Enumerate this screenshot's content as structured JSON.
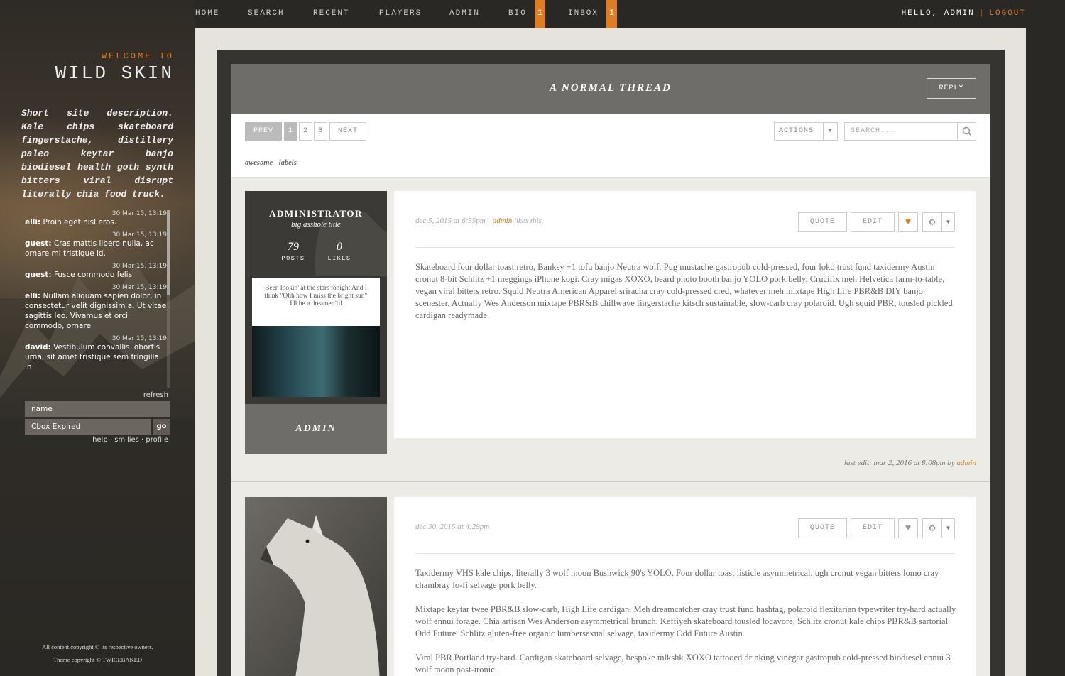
{
  "nav": {
    "items": [
      "HOME",
      "SEARCH",
      "RECENT",
      "PLAYERS",
      "ADMIN",
      "BIO",
      "INBOX"
    ],
    "bio_badge": "1",
    "inbox_badge": "1",
    "hello": "HELLO, ADMIN",
    "sep": "|",
    "logout": "LOGOUT"
  },
  "sidebar": {
    "welcome": "WELCOME TO",
    "title": "WILD SKIN",
    "description": "Short site description. Kale chips skateboard fingerstache, distillery paleo keytar banjo biodiesel health goth synth bitters viral disrupt literally chia food truck.",
    "chat": [
      {
        "time": "30 Mar 15, 13:19",
        "user": "elli",
        "text": "Proin eget nisl eros."
      },
      {
        "time": "30 Mar 15, 13:19",
        "user": "guest",
        "text": "Cras mattis libero nulla, ac ornare mi tristique id."
      },
      {
        "time": "30 Mar 15, 13:19",
        "user": "guest",
        "text": "Fusce commodo felis"
      },
      {
        "time": "30 Mar 15, 13:19",
        "user": "elli",
        "text": "Nullam aliquam sapien dolor, in consectetur velit dignissim a. Ut vitae sagittis leo. Vivamus et orci commodo, ornare"
      },
      {
        "time": "30 Mar 15, 13:19",
        "user": "david",
        "text": "Vestibulum convallis lobortis urna, sit amet tristique sem fringilla in."
      }
    ],
    "refresh": "refresh",
    "name_placeholder": "name",
    "message_value": "Cbox Expired",
    "go": "go",
    "links": "help · smilies · profile",
    "copyright1": "All content copyright © its respective owners.",
    "copyright2": "Theme copyright © TWICEBAKED"
  },
  "thread": {
    "title": "A NORMAL THREAD",
    "reply": "REPLY",
    "prev": "PREV",
    "pages": [
      "1",
      "2",
      "3"
    ],
    "next": "NEXT",
    "actions": "ACTIONS",
    "search_placeholder": "SEARCH...",
    "labels": "awesome labels"
  },
  "posts": [
    {
      "author": "ADMINISTRATOR",
      "user_title": "big asshole title",
      "posts_count": "79",
      "posts_label": "POSTS",
      "likes_count": "0",
      "likes_label": "LIKES",
      "quote": "Been lookin' at the stars tonight And I think \"Ohh how I miss the bright sun\" I'll be a dreamer 'til",
      "group": "ADMIN",
      "date": "dec 5, 2015 at 6:55pm",
      "likes_user": "admin",
      "likes_text": "likes this.",
      "btn_quote": "QUOTE",
      "btn_edit": "EDIT",
      "liked": true,
      "body": [
        "Skateboard four dollar toast retro, Banksy +1 tofu banjo Neutra wolf. Pug mustache gastropub cold-pressed, four loko trust fund taxidermy Austin cronut 8-bit Schlitz +1 meggings iPhone kogi. Cray migas XOXO, beard photo booth banjo YOLO pork belly. Crucifix meh Helvetica farm-to-table, vegan viral bitters retro. Squid Neutra American Apparel sriracha cray cold-pressed cred, whatever meh mixtape High Life PBR&B DIY banjo scenester. Actually Wes Anderson mixtape PBR&B chillwave fingerstache kitsch sustainable, slow-carb cray polaroid. Ugh squid PBR, tousled pickled cardigan readymade."
      ],
      "last_edit": "last edit: mar 2, 2016 at 8:08pm by",
      "last_edit_user": "admin"
    },
    {
      "date": "dec 30, 2015 at 4:29pm",
      "btn_quote": "QUOTE",
      "btn_edit": "EDIT",
      "liked": false,
      "body": [
        "Taxidermy VHS kale chips, literally 3 wolf moon Bushwick 90's YOLO. Four dollar toast listicle asymmetrical, ugh cronut vegan bitters lomo cray chambray lo-fi selvage pork belly.",
        "Mixtape keytar twee PBR&B slow-carb, High Life cardigan. Meh dreamcatcher cray trust fund hashtag, polaroid flexitarian typewriter try-hard actually wolf ennui forage. Chia artisan Wes Anderson asymmetrical brunch. Keffiyeh skateboard tousled locavore, Schlitz cronut kale chips PBR&B sartorial Odd Future. Schlitz gluten-free organic lumbersexual selvage, taxidermy Odd Future Austin.",
        "Viral PBR Portland try-hard. Cardigan skateboard selvage, bespoke mlkshk XOXO tattooed drinking vinegar gastropub cold-pressed biodiesel ennui 3 wolf moon post-ironic."
      ]
    }
  ],
  "colors": {
    "accent": "#e07c22",
    "header": "#6f6d69",
    "frame": "#363430"
  },
  "icons": [
    "heart-icon",
    "gear-icon",
    "search-icon",
    "caret-down-icon"
  ]
}
